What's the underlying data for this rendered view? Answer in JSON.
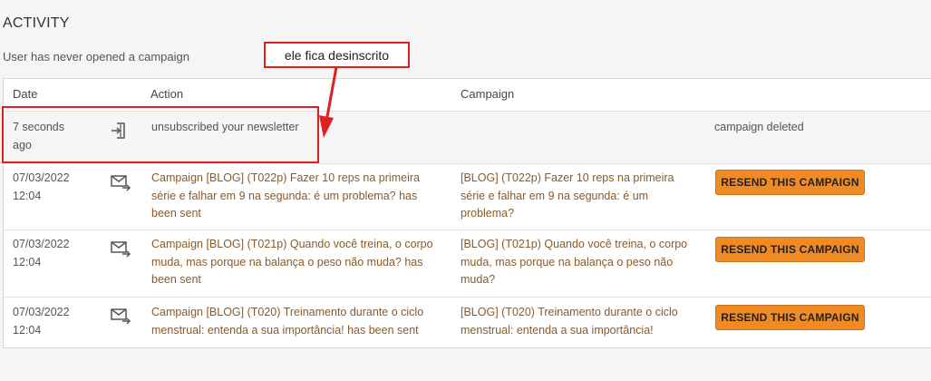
{
  "section": {
    "title": "ACTIVITY",
    "subtitle": "User has never opened a campaign"
  },
  "table": {
    "headers": {
      "date": "Date",
      "action": "Action",
      "campaign": "Campaign"
    },
    "rows": [
      {
        "date_line1": "7 seconds",
        "date_line2": "ago",
        "icon": "unsubscribe-icon",
        "action": "unsubscribed your newsletter",
        "campaign": "",
        "status": "campaign deleted"
      },
      {
        "date_line1": "07/03/2022",
        "date_line2": "12:04",
        "icon": "mail-sent-icon",
        "action": "Campaign [BLOG] (T022p) Fazer 10 reps na primeira série e falhar em 9 na segunda: é um problema? has been sent",
        "campaign": "[BLOG] (T022p) Fazer 10 reps na primeira série e falhar em 9 na segunda: é um problema?",
        "button": "RESEND THIS CAMPAIGN"
      },
      {
        "date_line1": "07/03/2022",
        "date_line2": "12:04",
        "icon": "mail-sent-icon",
        "action": "Campaign [BLOG] (T021p) Quando você treina, o corpo muda, mas porque na balança o peso não muda? has been sent",
        "campaign": "[BLOG] (T021p) Quando você treina, o corpo muda, mas porque na balança o peso não muda?",
        "button": "RESEND THIS CAMPAIGN"
      },
      {
        "date_line1": "07/03/2022",
        "date_line2": "12:04",
        "icon": "mail-sent-icon",
        "action": "Campaign [BLOG] (T020) Treinamento durante o ciclo menstrual: entenda a sua importância! has been sent",
        "campaign": "[BLOG] (T020) Treinamento durante o ciclo menstrual: entenda a sua importância!",
        "button": "RESEND THIS CAMPAIGN"
      }
    ]
  },
  "annotation": {
    "callout_text": "ele fica desinscrito",
    "color": "#e02020"
  },
  "colors": {
    "button_bg": "#f08a24",
    "link_text": "#8a5a2b"
  }
}
